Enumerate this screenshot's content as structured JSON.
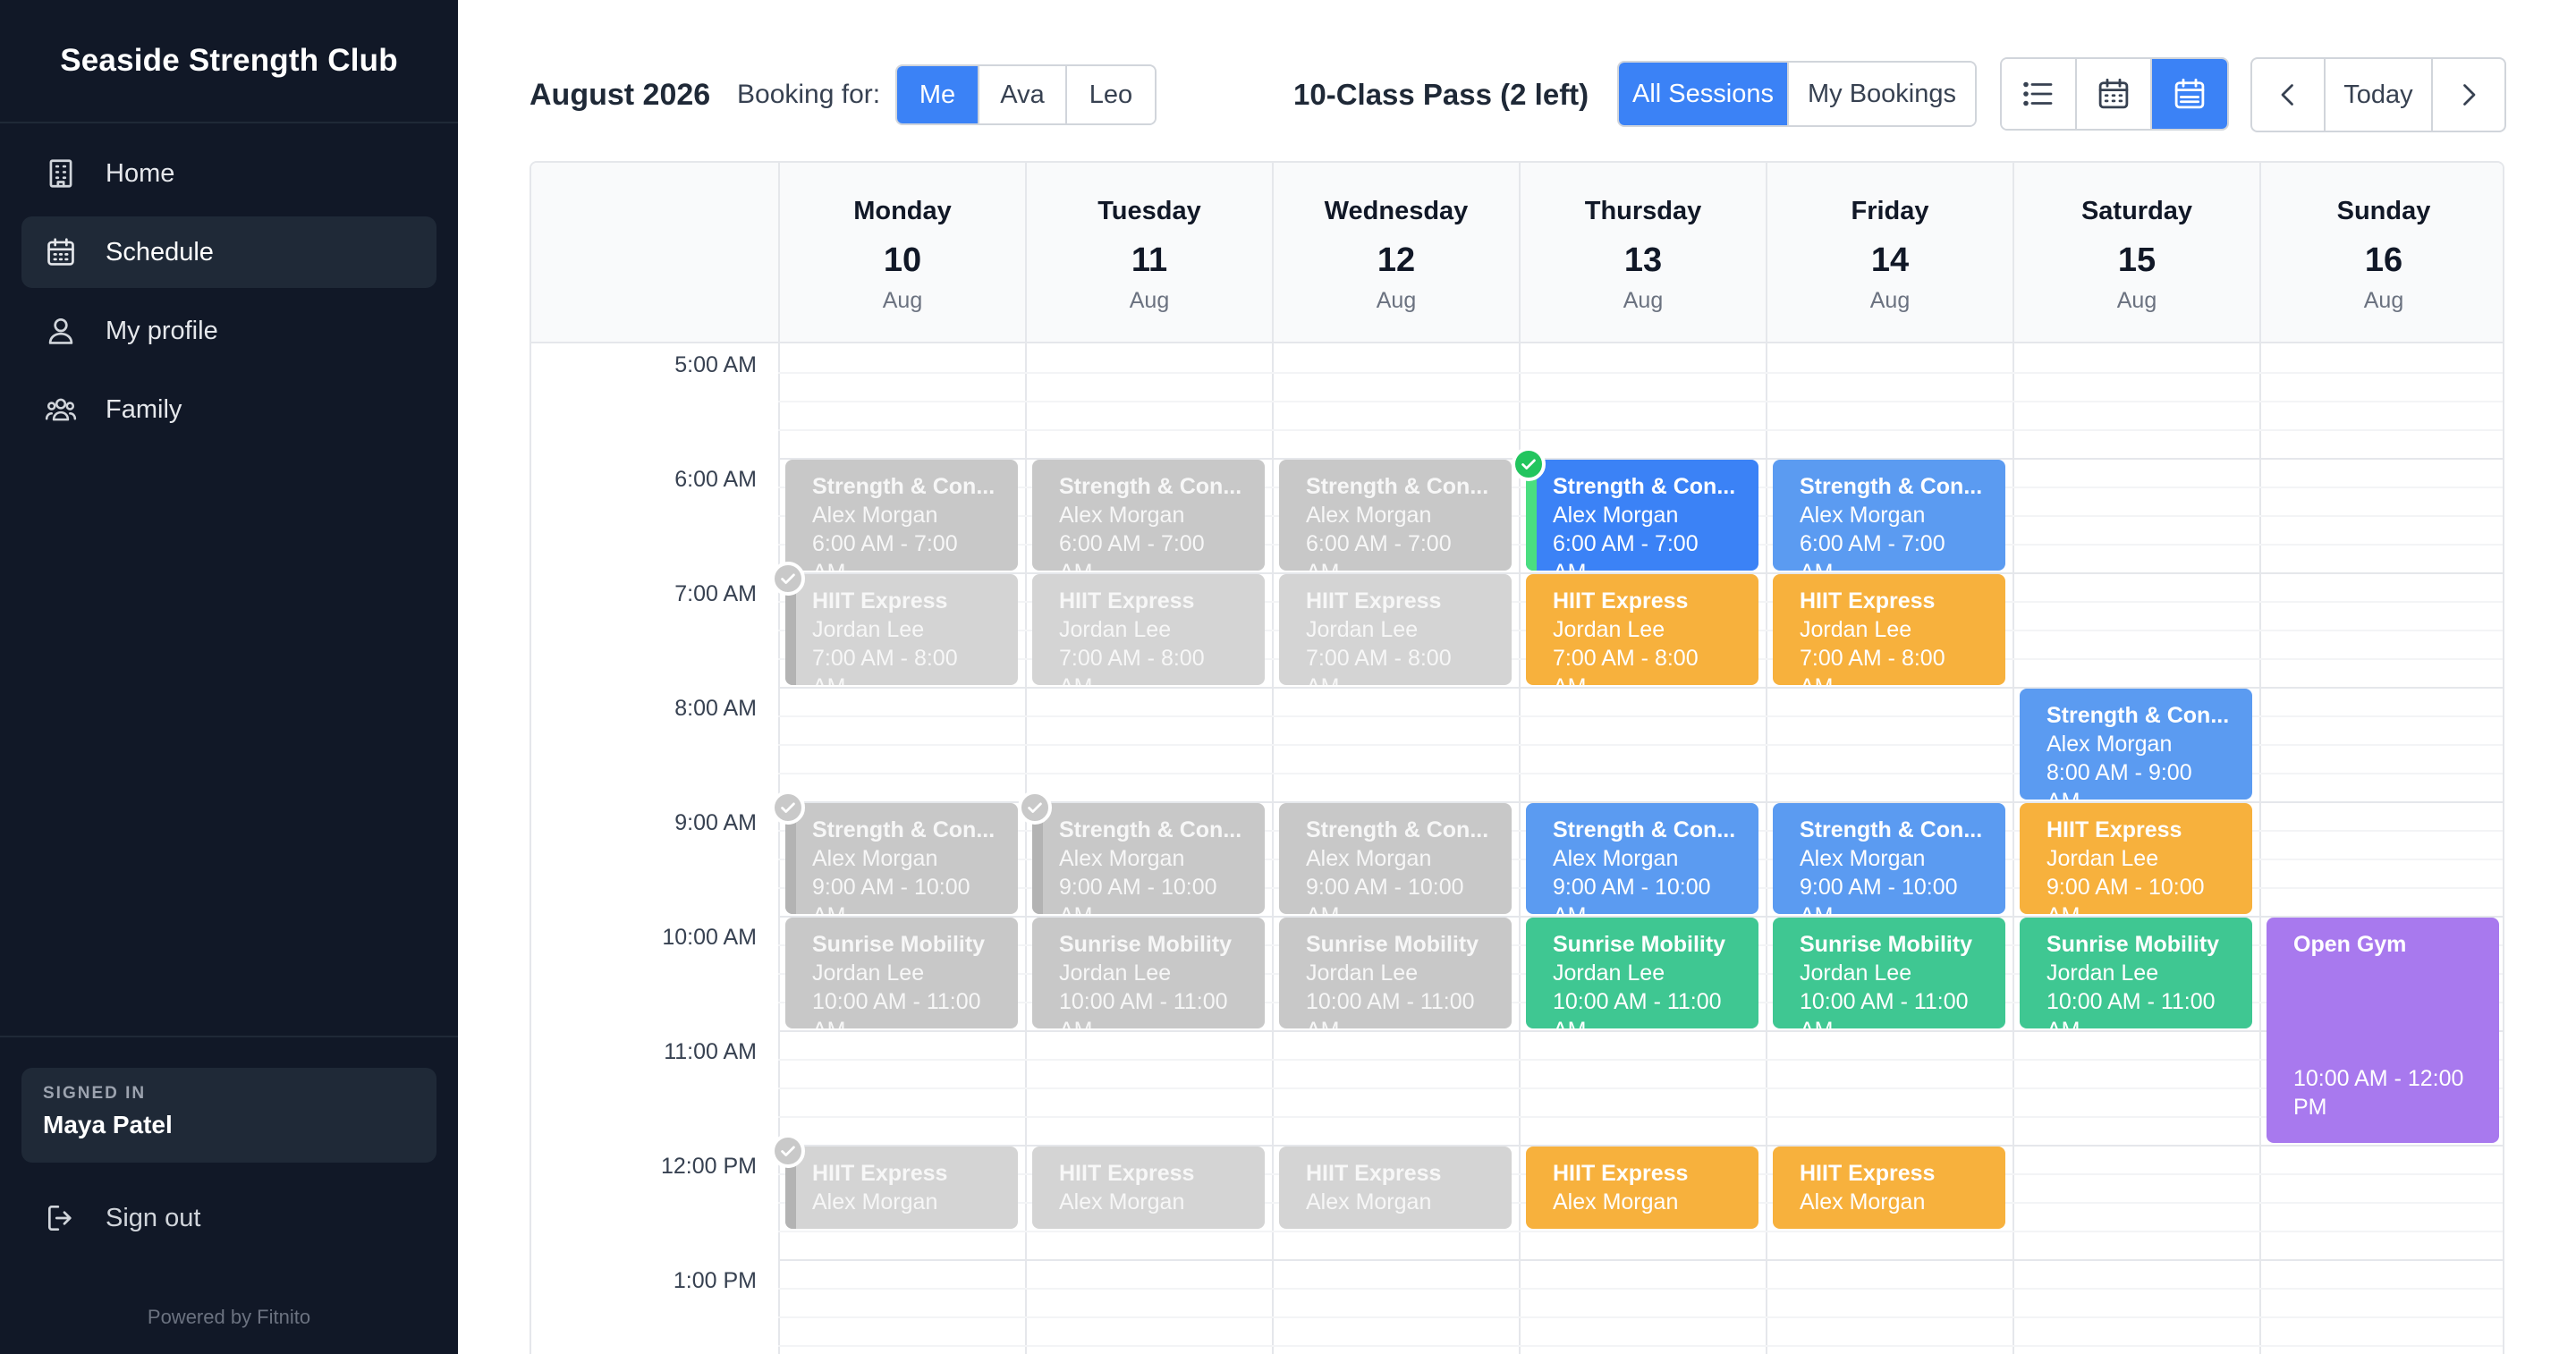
{
  "app": {
    "brand": "Seaside Strength Club"
  },
  "sidebar": {
    "items": [
      {
        "label": "Home",
        "icon": "building-icon"
      },
      {
        "label": "Schedule",
        "icon": "calendar-icon",
        "active": true
      },
      {
        "label": "My profile",
        "icon": "user-icon"
      },
      {
        "label": "Family",
        "icon": "users-icon"
      }
    ],
    "signed_in_label": "SIGNED IN",
    "user_name": "Maya Patel",
    "signout_label": "Sign out",
    "powered_by": "Powered by Fitnito"
  },
  "toolbar": {
    "month": "August 2026",
    "booking_for_label": "Booking for:",
    "people": [
      "Me",
      "Ava",
      "Leo"
    ],
    "selected_person": "Me",
    "pass_status": "10-Class Pass (2 left)",
    "filters": [
      "All Sessions",
      "My Bookings"
    ],
    "selected_filter": "All Sessions",
    "views": [
      "list-icon",
      "calendar-month-icon",
      "calendar-week-icon"
    ],
    "selected_view": "calendar-week-icon",
    "today_label": "Today"
  },
  "calendar": {
    "days": [
      {
        "name": "Monday",
        "num": "10",
        "month": "Aug"
      },
      {
        "name": "Tuesday",
        "num": "11",
        "month": "Aug"
      },
      {
        "name": "Wednesday",
        "num": "12",
        "month": "Aug"
      },
      {
        "name": "Thursday",
        "num": "13",
        "month": "Aug"
      },
      {
        "name": "Friday",
        "num": "14",
        "month": "Aug"
      },
      {
        "name": "Saturday",
        "num": "15",
        "month": "Aug"
      },
      {
        "name": "Sunday",
        "num": "16",
        "month": "Aug"
      }
    ],
    "hours": [
      "5:00 AM",
      "6:00 AM",
      "7:00 AM",
      "8:00 AM",
      "9:00 AM",
      "10:00 AM",
      "11:00 AM",
      "12:00 PM",
      "1:00 PM"
    ],
    "colors": {
      "past": "#c8c8c8",
      "strength": "#5b9bf1",
      "strength_booked": "#3b82f6",
      "hiit": "#f7b13d",
      "mobility": "#3fc792",
      "open_gym": "#a879ee",
      "booked_check": "#22c55e"
    },
    "events": [
      {
        "day": 0,
        "start": 6,
        "end": 7,
        "title": "Strength & Con...",
        "trainer": "Alex Morgan",
        "time": "6:00 AM - 7:00",
        "time_cont": "AM",
        "style": "grey"
      },
      {
        "day": 0,
        "start": 7,
        "end": 8,
        "title": "HIIT Express",
        "trainer": "Jordan Lee",
        "time": "7:00 AM - 8:00",
        "time_cont": "AM",
        "style": "grey-light",
        "booked": "past"
      },
      {
        "day": 0,
        "start": 9,
        "end": 10,
        "title": "Strength & Con...",
        "trainer": "Alex Morgan",
        "time": "9:00 AM - 10:00",
        "time_cont": "AM",
        "style": "grey",
        "booked": "past"
      },
      {
        "day": 0,
        "start": 10,
        "end": 11,
        "title": "Sunrise Mobility",
        "trainer": "Jordan Lee",
        "time": "10:00 AM - 11:00",
        "time_cont": "AM",
        "style": "grey"
      },
      {
        "day": 0,
        "start": 12,
        "end": 12.75,
        "title": "HIIT Express",
        "trainer": "Alex Morgan",
        "time": "",
        "time_cont": "",
        "style": "grey-light",
        "booked": "past"
      },
      {
        "day": 1,
        "start": 6,
        "end": 7,
        "title": "Strength & Con...",
        "trainer": "Alex Morgan",
        "time": "6:00 AM - 7:00",
        "time_cont": "AM",
        "style": "grey"
      },
      {
        "day": 1,
        "start": 7,
        "end": 8,
        "title": "HIIT Express",
        "trainer": "Jordan Lee",
        "time": "7:00 AM - 8:00",
        "time_cont": "AM",
        "style": "grey-light"
      },
      {
        "day": 1,
        "start": 9,
        "end": 10,
        "title": "Strength & Con...",
        "trainer": "Alex Morgan",
        "time": "9:00 AM - 10:00",
        "time_cont": "AM",
        "style": "grey",
        "booked": "past"
      },
      {
        "day": 1,
        "start": 10,
        "end": 11,
        "title": "Sunrise Mobility",
        "trainer": "Jordan Lee",
        "time": "10:00 AM - 11:00",
        "time_cont": "AM",
        "style": "grey"
      },
      {
        "day": 1,
        "start": 12,
        "end": 12.75,
        "title": "HIIT Express",
        "trainer": "Alex Morgan",
        "time": "",
        "time_cont": "",
        "style": "grey-light"
      },
      {
        "day": 2,
        "start": 6,
        "end": 7,
        "title": "Strength & Con...",
        "trainer": "Alex Morgan",
        "time": "6:00 AM - 7:00",
        "time_cont": "AM",
        "style": "grey"
      },
      {
        "day": 2,
        "start": 7,
        "end": 8,
        "title": "HIIT Express",
        "trainer": "Jordan Lee",
        "time": "7:00 AM - 8:00",
        "time_cont": "AM",
        "style": "grey-light"
      },
      {
        "day": 2,
        "start": 9,
        "end": 10,
        "title": "Strength & Con...",
        "trainer": "Alex Morgan",
        "time": "9:00 AM - 10:00",
        "time_cont": "AM",
        "style": "grey"
      },
      {
        "day": 2,
        "start": 10,
        "end": 11,
        "title": "Sunrise Mobility",
        "trainer": "Jordan Lee",
        "time": "10:00 AM - 11:00",
        "time_cont": "AM",
        "style": "grey"
      },
      {
        "day": 2,
        "start": 12,
        "end": 12.75,
        "title": "HIIT Express",
        "trainer": "Alex Morgan",
        "time": "",
        "time_cont": "",
        "style": "grey-light"
      },
      {
        "day": 3,
        "start": 6,
        "end": 7,
        "title": "Strength & Con...",
        "trainer": "Alex Morgan",
        "time": "6:00 AM - 7:00",
        "time_cont": "AM",
        "style": "blue-dark",
        "booked": "active"
      },
      {
        "day": 3,
        "start": 7,
        "end": 8,
        "title": "HIIT Express",
        "trainer": "Jordan Lee",
        "time": "7:00 AM - 8:00",
        "time_cont": "AM",
        "style": "orange"
      },
      {
        "day": 3,
        "start": 9,
        "end": 10,
        "title": "Strength & Con...",
        "trainer": "Alex Morgan",
        "time": "9:00 AM - 10:00",
        "time_cont": "AM",
        "style": "blue"
      },
      {
        "day": 3,
        "start": 10,
        "end": 11,
        "title": "Sunrise Mobility",
        "trainer": "Jordan Lee",
        "time": "10:00 AM - 11:00",
        "time_cont": "AM",
        "style": "green"
      },
      {
        "day": 3,
        "start": 12,
        "end": 12.75,
        "title": "HIIT Express",
        "trainer": "Alex Morgan",
        "time": "",
        "time_cont": "",
        "style": "orange"
      },
      {
        "day": 4,
        "start": 6,
        "end": 7,
        "title": "Strength & Con...",
        "trainer": "Alex Morgan",
        "time": "6:00 AM - 7:00",
        "time_cont": "AM",
        "style": "blue"
      },
      {
        "day": 4,
        "start": 7,
        "end": 8,
        "title": "HIIT Express",
        "trainer": "Jordan Lee",
        "time": "7:00 AM - 8:00",
        "time_cont": "AM",
        "style": "orange"
      },
      {
        "day": 4,
        "start": 9,
        "end": 10,
        "title": "Strength & Con...",
        "trainer": "Alex Morgan",
        "time": "9:00 AM - 10:00",
        "time_cont": "AM",
        "style": "blue"
      },
      {
        "day": 4,
        "start": 10,
        "end": 11,
        "title": "Sunrise Mobility",
        "trainer": "Jordan Lee",
        "time": "10:00 AM - 11:00",
        "time_cont": "AM",
        "style": "green"
      },
      {
        "day": 4,
        "start": 12,
        "end": 12.75,
        "title": "HIIT Express",
        "trainer": "Alex Morgan",
        "time": "",
        "time_cont": "",
        "style": "orange"
      },
      {
        "day": 5,
        "start": 8,
        "end": 9,
        "title": "Strength & Con...",
        "trainer": "Alex Morgan",
        "time": "8:00 AM - 9:00",
        "time_cont": "AM",
        "style": "blue"
      },
      {
        "day": 5,
        "start": 9,
        "end": 10,
        "title": "HIIT Express",
        "trainer": "Jordan Lee",
        "time": "9:00 AM - 10:00",
        "time_cont": "AM",
        "style": "orange"
      },
      {
        "day": 5,
        "start": 10,
        "end": 11,
        "title": "Sunrise Mobility",
        "trainer": "Jordan Lee",
        "time": "10:00 AM - 11:00",
        "time_cont": "AM",
        "style": "green"
      },
      {
        "day": 6,
        "start": 10,
        "end": 12,
        "title": "Open Gym",
        "trainer": "",
        "time": "10:00 AM - 12:00",
        "time_cont": "PM",
        "style": "purple",
        "time_at_bottom": true
      }
    ]
  }
}
